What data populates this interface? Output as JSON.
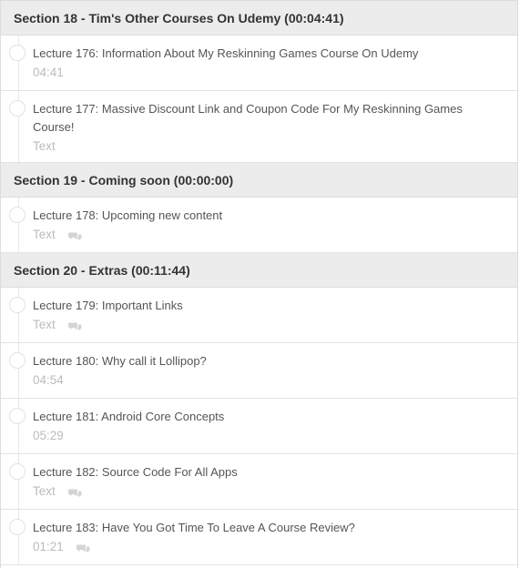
{
  "sections": [
    {
      "title": "Section 18 - Tim's Other Courses On Udemy (00:04:41)",
      "lectures": [
        {
          "title": "Lecture 176: Information About My Reskinning Games Course On Udemy",
          "meta": "04:41",
          "chat": false
        },
        {
          "title": "Lecture 177: Massive Discount Link and Coupon Code For My Reskinning Games Course!",
          "meta": "Text",
          "chat": false
        }
      ]
    },
    {
      "title": "Section 19 - Coming soon (00:00:00)",
      "lectures": [
        {
          "title": "Lecture 178: Upcoming new content",
          "meta": "Text",
          "chat": true
        }
      ]
    },
    {
      "title": "Section 20 - Extras (00:11:44)",
      "lectures": [
        {
          "title": "Lecture 179: Important Links",
          "meta": "Text",
          "chat": true
        },
        {
          "title": "Lecture 180: Why call it Lollipop?",
          "meta": "04:54",
          "chat": false
        },
        {
          "title": "Lecture 181: Android Core Concepts",
          "meta": "05:29",
          "chat": false
        },
        {
          "title": "Lecture 182: Source Code For All Apps",
          "meta": "Text",
          "chat": true
        },
        {
          "title": "Lecture 183: Have You Got Time To Leave A Course Review?",
          "meta": "01:21",
          "chat": true
        }
      ]
    }
  ],
  "icons": {
    "progress": "circle-outline-icon",
    "discussion": "chat-bubbles-icon"
  },
  "colors": {
    "section_bg": "#ececec",
    "title_text": "#555555",
    "meta_text": "#bbbbbb"
  }
}
